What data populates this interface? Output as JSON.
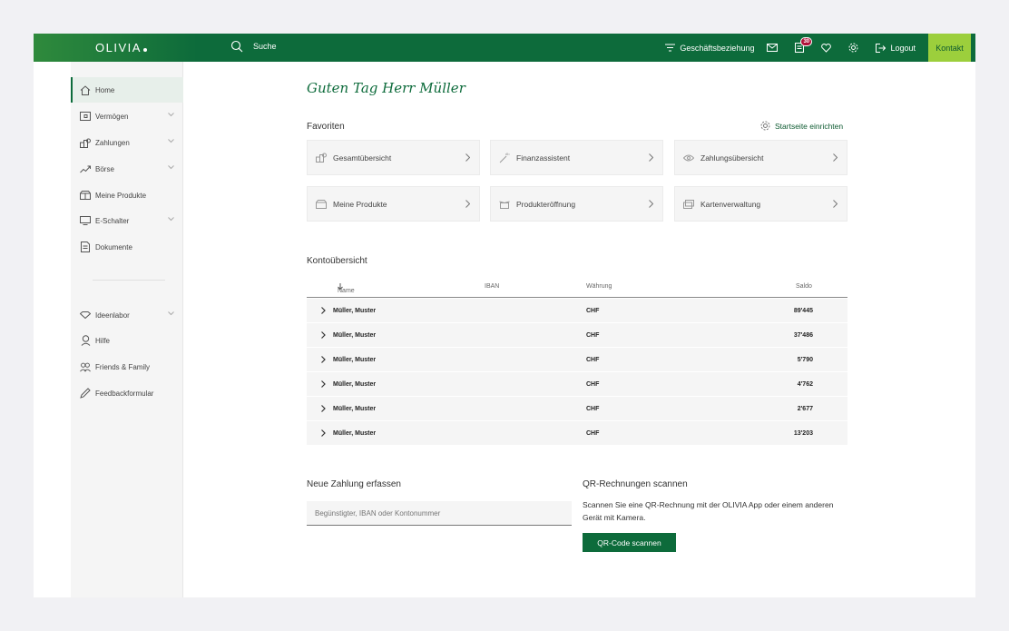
{
  "topbar": {
    "logo": "OLIVIA",
    "search_label": "Suche",
    "relationship_label": "Geschäftsbeziehung",
    "inbox_badge": "30",
    "logout_label": "Logout",
    "contact_label": "Kontakt"
  },
  "sidebar": {
    "items": [
      {
        "label": "Home",
        "icon": "home-icon"
      },
      {
        "label": "Vermögen",
        "icon": "wallet-icon"
      },
      {
        "label": "Zahlungen",
        "icon": "coins-icon"
      },
      {
        "label": "Börse",
        "icon": "trend-icon"
      },
      {
        "label": "Meine Produkte",
        "icon": "box-icon"
      },
      {
        "label": "E-Schalter",
        "icon": "monitor-icon"
      },
      {
        "label": "Dokumente",
        "icon": "document-icon"
      },
      {
        "label": "Ideenlabor",
        "icon": "diamond-icon"
      },
      {
        "label": "Hilfe",
        "icon": "help-icon"
      },
      {
        "label": "Friends & Family",
        "icon": "people-icon"
      },
      {
        "label": "Feedbackformular",
        "icon": "pencil-icon"
      }
    ]
  },
  "main": {
    "greeting": "Guten Tag Herr Müller",
    "favorites_title": "Favoriten",
    "setup_link": "Startseite einrichten",
    "favorites": [
      {
        "label": "Gesamtübersicht",
        "icon": "coins-icon"
      },
      {
        "label": "Finanzassistent",
        "icon": "wand-icon"
      },
      {
        "label": "Zahlungsübersicht",
        "icon": "eye-icon"
      },
      {
        "label": "Meine Produkte",
        "icon": "box-icon"
      },
      {
        "label": "Produkteröffnung",
        "icon": "box-open-icon"
      },
      {
        "label": "Kartenverwaltung",
        "icon": "cards-icon"
      }
    ],
    "accounts_title": "Kontoübersicht",
    "accounts_columns": {
      "name": "Name",
      "iban": "IBAN",
      "currency": "Währung",
      "balance": "Saldo"
    },
    "accounts": [
      {
        "name": "Müller, Muster",
        "currency": "CHF",
        "balance": "89'445"
      },
      {
        "name": "Müller, Muster",
        "currency": "CHF",
        "balance": "37'486"
      },
      {
        "name": "Müller, Muster",
        "currency": "CHF",
        "balance": "5'790"
      },
      {
        "name": "Müller, Muster",
        "currency": "CHF",
        "balance": "4'762"
      },
      {
        "name": "Müller, Muster",
        "currency": "CHF",
        "balance": "2'677"
      },
      {
        "name": "Müller, Muster",
        "currency": "CHF",
        "balance": "13'203"
      }
    ],
    "payment_title": "Neue Zahlung erfassen",
    "payment_placeholder": "Begünstigter, IBAN oder Kontonummer",
    "qr_title": "QR-Rechnungen scannen",
    "qr_text": "Scannen Sie eine QR-Rechnung mit der OLIVIA App oder einem anderen Gerät mit Kamera.",
    "qr_button": "QR-Code scannen"
  },
  "colors": {
    "brand_green": "#0d6b3b",
    "accent_lime": "#9ccf3c",
    "badge_red": "#b0123a"
  }
}
